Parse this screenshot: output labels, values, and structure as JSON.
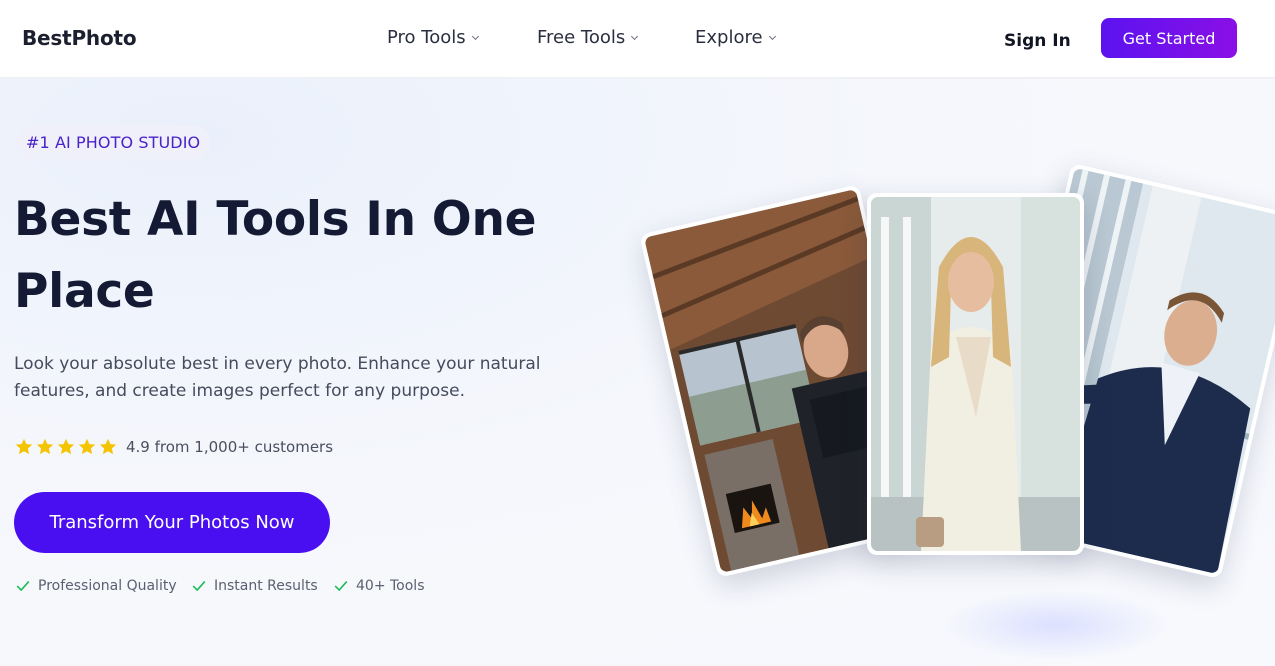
{
  "header": {
    "logo": "BestPhoto",
    "nav": [
      {
        "label": "Pro Tools"
      },
      {
        "label": "Free Tools"
      },
      {
        "label": "Explore"
      }
    ],
    "sign_in": "Sign In",
    "get_started": "Get Started"
  },
  "hero": {
    "badge": "#1 AI PHOTO STUDIO",
    "headline_line1": "Best AI Tools In One",
    "headline_line2": "Place",
    "subtext": "Look your absolute best in every photo. Enhance your natural features, and create images perfect for any purpose.",
    "rating": {
      "stars": 5,
      "text": "4.9 from 1,000+ customers",
      "star_color": "#f5c400"
    },
    "cta": "Transform Your Photos Now",
    "features": [
      {
        "label": "Professional Quality",
        "icon": "check-icon"
      },
      {
        "label": "Instant Results",
        "icon": "check-icon"
      },
      {
        "label": "40+ Tools",
        "icon": "check-icon"
      }
    ],
    "check_color": "#1fba5a"
  },
  "colors": {
    "accent": "#4a0ff0",
    "gradient_start": "#5b13f0",
    "gradient_end": "#8a0fe6",
    "badge_text": "#4a22c9"
  }
}
